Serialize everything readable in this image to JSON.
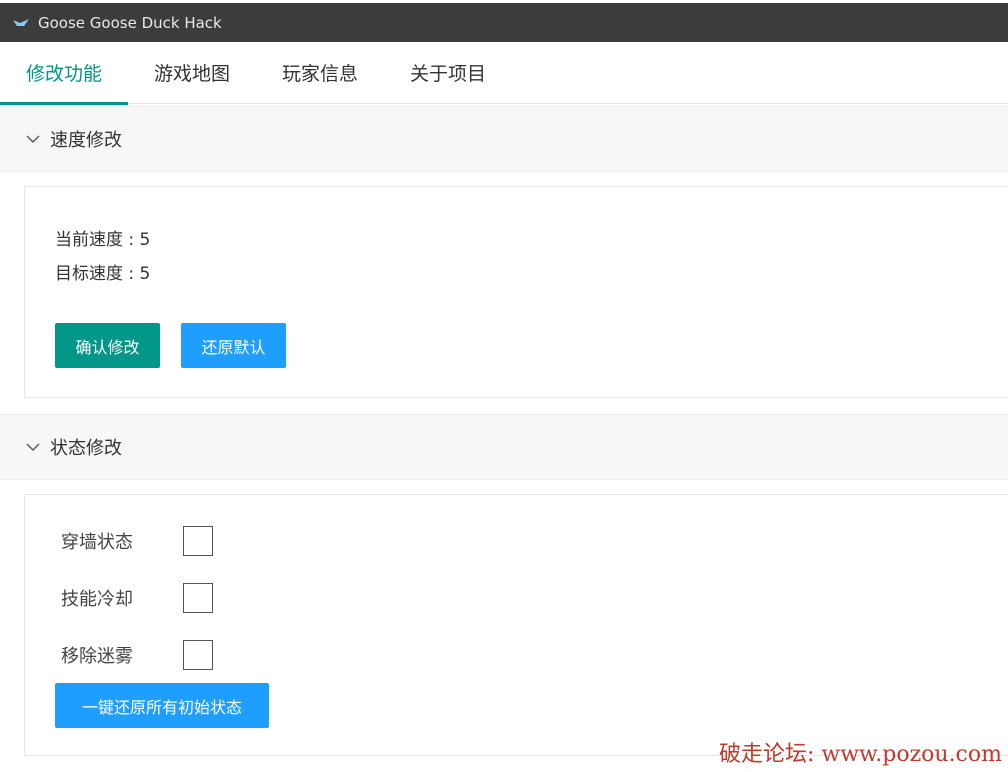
{
  "window": {
    "title": "Goose Goose Duck Hack"
  },
  "tabs": [
    {
      "label": "修改功能",
      "active": true
    },
    {
      "label": "游戏地图",
      "active": false
    },
    {
      "label": "玩家信息",
      "active": false
    },
    {
      "label": "关于项目",
      "active": false
    }
  ],
  "speed_section": {
    "header": "速度修改",
    "current_speed_label": "当前速度 : 5",
    "target_speed_label": "目标速度 : 5",
    "confirm_button": "确认修改",
    "restore_button": "还原默认"
  },
  "status_section": {
    "header": "状态修改",
    "options": [
      {
        "label": "穿墙状态",
        "checked": false
      },
      {
        "label": "技能冷却",
        "checked": false
      },
      {
        "label": "移除迷雾",
        "checked": false
      }
    ],
    "reset_all_button": "一键还原所有初始状态"
  },
  "watermark": "破走论坛: www.pozou.com",
  "colors": {
    "accent": "#009688",
    "blue": "#1e9fff",
    "titlebar": "#3c3c3c"
  }
}
